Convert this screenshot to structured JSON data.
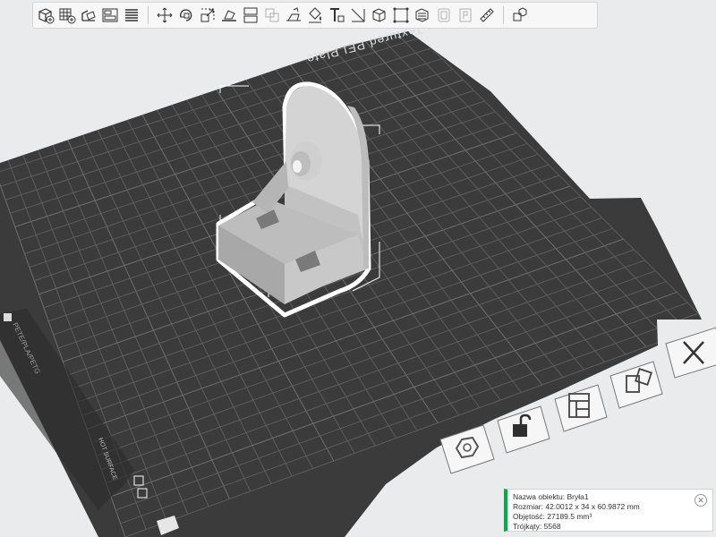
{
  "plate": {
    "label": "Bambu Textured PEI Plate",
    "side_label": "PETE/PLA/PETG",
    "side_badge": "HOT SURFACE"
  },
  "toolbar": {
    "buttons": [
      {
        "name": "add-object",
        "icon": "cube-plus-icon"
      },
      {
        "name": "add-plate",
        "icon": "grid-plus-icon"
      },
      {
        "name": "auto-orient",
        "icon": "orient-icon"
      },
      {
        "name": "arrange",
        "icon": "arrange-icon"
      },
      {
        "name": "split-plates",
        "icon": "layers-icon"
      },
      {
        "name": "move",
        "icon": "move-icon"
      },
      {
        "name": "rotate",
        "icon": "rotate-icon"
      },
      {
        "name": "scale",
        "icon": "scale-icon"
      },
      {
        "name": "lay-on-face",
        "icon": "lay-face-icon"
      },
      {
        "name": "cut",
        "icon": "cut-icon"
      },
      {
        "name": "boolean",
        "icon": "boolean-icon",
        "disabled": true
      },
      {
        "name": "support-paint",
        "icon": "support-paint-icon"
      },
      {
        "name": "color-paint",
        "icon": "paint-bucket-icon"
      },
      {
        "name": "text",
        "icon": "text-icon"
      },
      {
        "name": "measure",
        "icon": "measure-icon"
      },
      {
        "name": "assembly",
        "icon": "assembly-icon"
      },
      {
        "name": "drill",
        "icon": "variable-layer-icon"
      },
      {
        "name": "seam",
        "icon": "seam-icon"
      },
      {
        "name": "brim-ears",
        "icon": "brim-ears-icon",
        "disabled": true
      },
      {
        "name": "emboss",
        "icon": "emboss-icon",
        "disabled": true
      },
      {
        "name": "ruler",
        "icon": "ruler-icon"
      },
      {
        "name": "explode",
        "icon": "explode-icon"
      }
    ]
  },
  "side_buttons": [
    {
      "name": "object-list",
      "icon": "hexagon-icon"
    },
    {
      "name": "unlock",
      "icon": "unlock-icon"
    },
    {
      "name": "layout",
      "icon": "layout-icon"
    },
    {
      "name": "auto-arrange",
      "icon": "auto-arrange-icon"
    },
    {
      "name": "close-plate",
      "icon": "close-icon"
    }
  ],
  "object_info": {
    "name_line": "Nazwa obiektu: Bryła1",
    "size_line": "Rozmiar: 42.0012 x 34 x 60.9872 mm",
    "volume_line": "Objętość: 27189.5 mm³",
    "triangles_line": "Trójkąty: 5568"
  },
  "colors": {
    "plate": "#3c3c3c",
    "grid": "#5a5a5a",
    "model": "#d9d9d9",
    "accent": "#00ae42"
  }
}
